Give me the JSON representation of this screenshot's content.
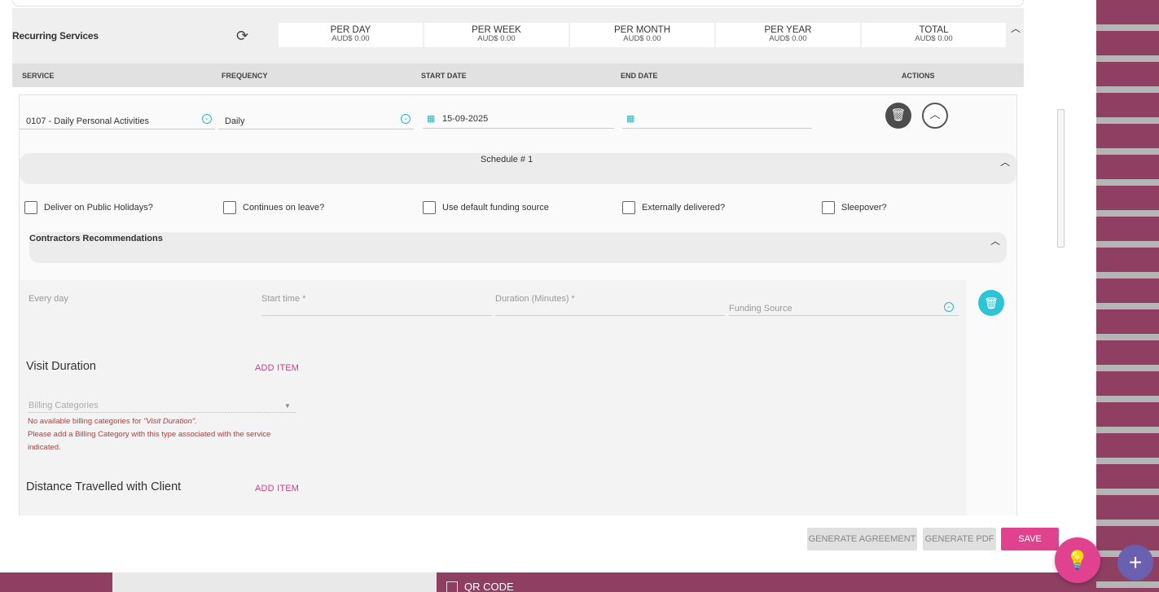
{
  "background": {
    "qr_label": "QR CODE"
  },
  "recurring": {
    "title": "Recurring Services",
    "totals": [
      {
        "label": "PER DAY",
        "value": "AUD$ 0.00"
      },
      {
        "label": "PER WEEK",
        "value": "AUD$ 0.00"
      },
      {
        "label": "PER MONTH",
        "value": "AUD$ 0.00"
      },
      {
        "label": "PER YEAR",
        "value": "AUD$ 0.00"
      },
      {
        "label": "TOTAL",
        "value": "AUD$ 0.00"
      }
    ]
  },
  "columns": {
    "service": "SERVICE",
    "frequency": "FREQUENCY",
    "start_date": "START DATE",
    "end_date": "END DATE",
    "actions": "ACTIONS"
  },
  "row": {
    "service": "0107 - Daily Personal Activities",
    "frequency": "Daily",
    "start_date": "15-09-2025",
    "end_date": ""
  },
  "schedule": {
    "title": "Schedule # 1"
  },
  "checkboxes": [
    {
      "label": "Deliver on Public Holidays?",
      "checked": false
    },
    {
      "label": "Continues on leave?",
      "checked": false
    },
    {
      "label": "Use default funding source",
      "checked": false
    },
    {
      "label": "Externally delivered?",
      "checked": false
    },
    {
      "label": "Sleepover?",
      "checked": false
    }
  ],
  "contractors": {
    "title": "Contractors Recommendations"
  },
  "detail": {
    "every_day": "Every day",
    "start_time": "Start time *",
    "duration": "Duration (Minutes) *",
    "funding_source": "Funding Source"
  },
  "visit_duration": {
    "title": "Visit Duration",
    "add_item": "ADD ITEM",
    "billing_placeholder": "Billing Categories",
    "error_line1_prefix": "No available billing categories for ",
    "error_line1_em": "\"Visit Duration\".",
    "error_line2": "Please add a Billing Category with this type associated with the service indicated."
  },
  "distance": {
    "title": "Distance Travelled with Client",
    "add_item": "ADD ITEM"
  },
  "footer": {
    "generate_agreement": "GENERATE AGREEMENT",
    "generate_pdf": "GENERATE PDF",
    "save": "SAVE"
  },
  "colors": {
    "accent_pink": "#e0428f",
    "teal": "#2ec4d6",
    "fab_purple": "#6b5fb0"
  }
}
